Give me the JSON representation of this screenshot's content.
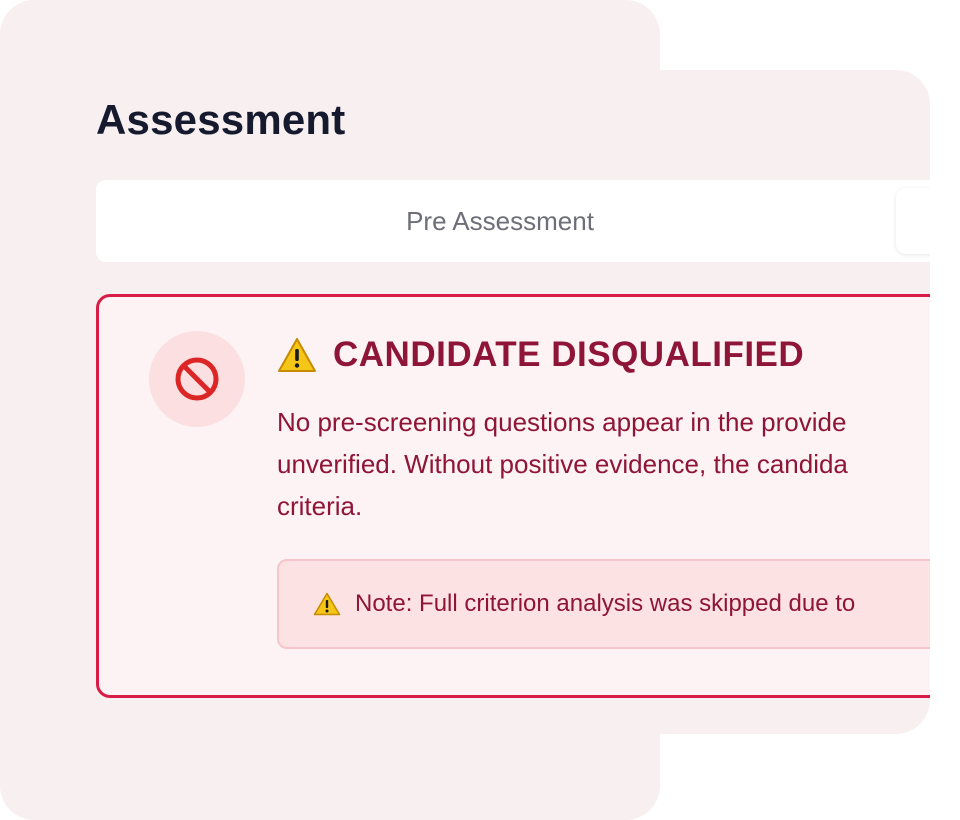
{
  "page": {
    "title": "Assessment"
  },
  "tabs": [
    {
      "label": "Pre Assessment",
      "active": false
    },
    {
      "label": "",
      "active": true
    }
  ],
  "alert": {
    "icon": "prohibited-icon",
    "heading_icon": "warning-icon",
    "title": "CANDIDATE DISQUALIFIED",
    "body_lines": [
      "No pre-screening questions appear in the provide",
      "unverified. Without positive evidence, the candida",
      "criteria."
    ],
    "note": {
      "icon": "warning-icon",
      "text": "Note: Full criterion analysis was skipped due to"
    }
  },
  "colors": {
    "background": "#f8f0f0",
    "alert_border": "#d81c46",
    "alert_text": "#8f1538",
    "alert_fill": "#fdf3f4",
    "note_fill": "#fde2e4",
    "warning": "#f5c518"
  }
}
